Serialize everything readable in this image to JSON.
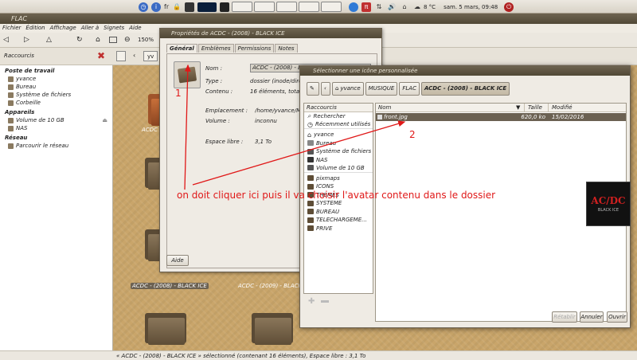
{
  "topbar": {
    "keyboard_layout": "fr",
    "weather": "8 °C",
    "clock": "sam. 5 mars, 09:48"
  },
  "file_manager": {
    "window_title": "FLAC",
    "menu": [
      "Fichier",
      "Édition",
      "Affichage",
      "Aller à",
      "Signets",
      "Aide"
    ],
    "zoom": "150%",
    "location_crumb": "yv",
    "sidebar": {
      "selector_label": "Raccourcis",
      "sections": [
        {
          "title": "Poste de travail",
          "items": [
            "yvance",
            "Bureau",
            "Système de fichiers",
            "Corbeille"
          ]
        },
        {
          "title": "Appareils",
          "items": [
            "Volume de 10 GB",
            "NAS"
          ]
        },
        {
          "title": "Réseau",
          "items": [
            "Parcourir le réseau"
          ]
        }
      ]
    },
    "folders": {
      "label_partial": "ACDC - (20",
      "label_2008": "ACDC - (2008) - BLACK ICE",
      "label_2009": "ACDC - (2009) - BLACK ICE"
    },
    "status": "« ACDC - (2008) - BLACK ICE » sélectionné (contenant 16 éléments), Espace libre : 3,1 To"
  },
  "properties_dialog": {
    "title": "Propriétés de ACDC - (2008) - BLACK ICE",
    "tabs": [
      "Général",
      "Emblèmes",
      "Permissions",
      "Notes"
    ],
    "fields": {
      "name_label": "Nom :",
      "name_value": "ACDC - (2008) - BLACK ICE",
      "type_label": "Type :",
      "type_value": "dossier (inode/directory)",
      "contents_label": "Contenu :",
      "contents_value": "16 éléments, total 2,2 Go",
      "location_label": "Emplacement :",
      "location_value": "/home/yvance/MUSIQUE/FLAC",
      "volume_label": "Volume :",
      "volume_value": "inconnu",
      "free_label": "Espace libre :",
      "free_value": "3,1 To"
    },
    "help_button": "Aide"
  },
  "icon_chooser": {
    "title": "Sélectionner une icône personnalisée",
    "path": [
      "yvance",
      "MUSIQUE",
      "FLAC",
      "ACDC - (2008) - BLACK ICE"
    ],
    "places_header": "Raccourcis",
    "places": [
      {
        "label": "Rechercher",
        "icon": "search-icon"
      },
      {
        "label": "Récemment utilisés",
        "icon": "clock-icon"
      },
      {
        "label": "yvance",
        "icon": "home-icon"
      },
      {
        "label": "Bureau",
        "icon": "desktop-icon"
      },
      {
        "label": "Système de fichiers",
        "icon": "drive-icon"
      },
      {
        "label": "NAS",
        "icon": "drive-icon"
      },
      {
        "label": "Volume de 10 GB",
        "icon": "drive-icon"
      },
      {
        "label": "pixmaps",
        "icon": "folder-icon"
      },
      {
        "label": "ICONS",
        "icon": "folder-icon"
      },
      {
        "label": "THEMES",
        "icon": "folder-icon"
      },
      {
        "label": "SYSTEME",
        "icon": "folder-icon"
      },
      {
        "label": "BUREAU",
        "icon": "folder-icon"
      },
      {
        "label": "TELECHARGEME...",
        "icon": "folder-icon"
      },
      {
        "label": "PRIVE",
        "icon": "folder-icon"
      }
    ],
    "columns": {
      "name": "Nom",
      "size": "Taille",
      "modified": "Modifié"
    },
    "files": [
      {
        "name": "front.jpg",
        "size": "620,0 ko",
        "modified": "15/02/2016"
      }
    ],
    "buttons": {
      "reset": "Rétablir",
      "cancel": "Annuler",
      "open": "Ouvrir"
    }
  },
  "album_art": {
    "brand": "AC/DC",
    "subtitle": "BLACK ICE"
  },
  "annotations": {
    "marker_1": "1",
    "marker_2": "2",
    "instruction": "on doit cliquer ici puis il va choisir l'avatar contenu dans le dossier",
    "color": "#e01818"
  }
}
